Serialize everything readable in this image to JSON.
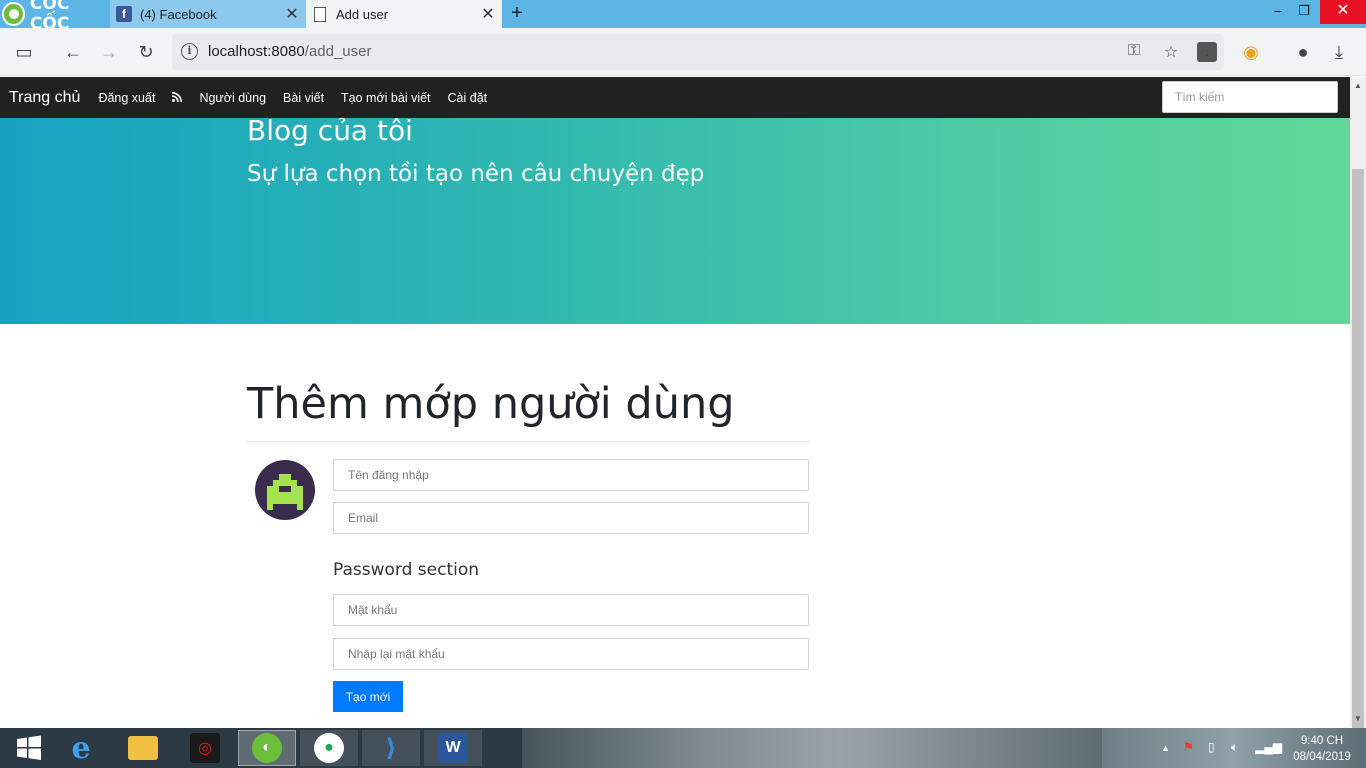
{
  "browser": {
    "brand": "CỐC CỐC",
    "tabs": [
      {
        "title": "(4) Facebook",
        "favicon": "facebook-icon"
      },
      {
        "title": "Add user",
        "favicon": "page-icon"
      }
    ],
    "url_host": "localhost:8080",
    "url_path": "/add_user"
  },
  "navbar": {
    "site_title": "Trang chủ",
    "links": [
      "Đăng xuất",
      "Người dùng",
      "Bài viết",
      "Tạo mới bài viết",
      "Cài đặt"
    ],
    "rss_icon": "rss-icon",
    "search_placeholder": "Tìm kiếm"
  },
  "hero": {
    "title": "Blog của tôi",
    "subtitle": "Sự lựa chọn tồi tạo nên câu chuyện đẹp"
  },
  "form": {
    "heading": "Thêm mớp người dùng",
    "username_placeholder": "Tên đăng nhập",
    "email_placeholder": "Email",
    "password_section": "Password section",
    "password_placeholder": "Mật khẩu",
    "password_confirm_placeholder": "Nhập lại mật khẩu",
    "submit_label": "Tạo mới"
  },
  "taskbar": {
    "time": "9:40 CH",
    "date": "08/04/2019"
  },
  "colors": {
    "navbar": "#212121",
    "hero_start": "#17a2c3",
    "hero_end": "#62d798",
    "button": "#007bff"
  }
}
